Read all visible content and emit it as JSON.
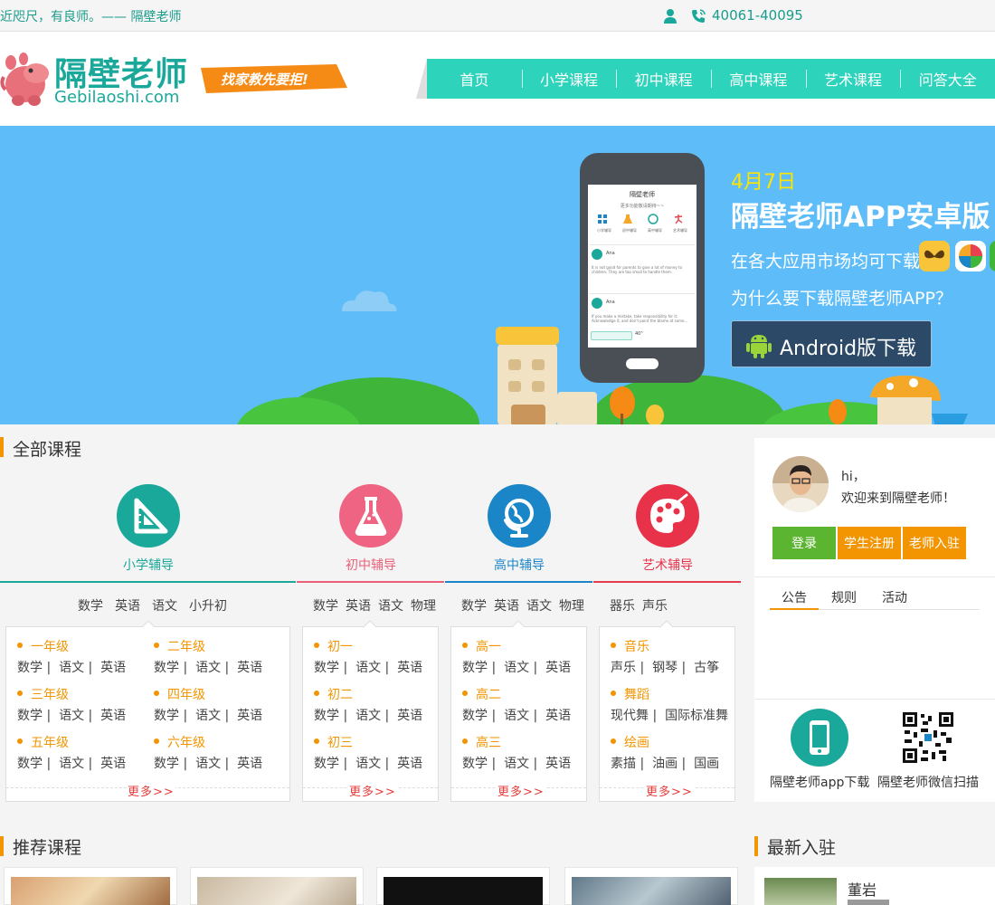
{
  "topbar": {
    "slogan": "近咫尺，有良师。—— 隔壁老师",
    "phone": "40061-40095"
  },
  "logo": {
    "name_cn": "隔壁老师",
    "name_en": "Gebilaoshi.com",
    "tagline": "找家教先要拒!"
  },
  "nav": {
    "items": [
      "首页",
      "小学课程",
      "初中课程",
      "高中课程",
      "艺术课程",
      "问答大全"
    ]
  },
  "banner": {
    "date": "4月7日",
    "title": "隔壁老师APP安卓版",
    "sub1": "在各大应用市场均可下载",
    "sub2": "为什么要下载隔壁老师APP？",
    "android_button": "Android版下载",
    "phone_screen": {
      "title": "隔壁老师",
      "subtitle": "更多功能敬请期待~~",
      "icons": [
        "小学辅导",
        "初中辅导",
        "高中辅导",
        "艺术辅导"
      ],
      "posts": [
        {
          "name": "Ana",
          "text": "It is not good for parents to give a lot of money to children. They are too small to handle them."
        },
        {
          "name": "Ana",
          "text": "If you make a mistake, take responsibility for it. Acknowledge it, and don't point the blame at some..."
        }
      ],
      "audio": "40\""
    }
  },
  "courses": {
    "title": "全部课程",
    "more": "更多>>",
    "categories": [
      {
        "label": "小学辅导",
        "color": "#1aa89a",
        "tabs": [
          "数学",
          "英语",
          "语文",
          "小升初"
        ],
        "groups": [
          {
            "name": "一年级",
            "subjects": [
              "数学",
              "语文",
              "英语"
            ]
          },
          {
            "name": "二年级",
            "subjects": [
              "数学",
              "语文",
              "英语"
            ]
          },
          {
            "name": "三年级",
            "subjects": [
              "数学",
              "语文",
              "英语"
            ]
          },
          {
            "name": "四年级",
            "subjects": [
              "数学",
              "语文",
              "英语"
            ]
          },
          {
            "name": "五年级",
            "subjects": [
              "数学",
              "语文",
              "英语"
            ]
          },
          {
            "name": "六年级",
            "subjects": [
              "数学",
              "语文",
              "英语"
            ]
          }
        ]
      },
      {
        "label": "初中辅导",
        "color": "#e8607a",
        "tabs": [
          "数学",
          "英语",
          "语文",
          "物理"
        ],
        "groups": [
          {
            "name": "初一",
            "subjects": [
              "数学",
              "语文",
              "英语"
            ]
          },
          {
            "name": "初二",
            "subjects": [
              "数学",
              "语文",
              "英语"
            ]
          },
          {
            "name": "初三",
            "subjects": [
              "数学",
              "语文",
              "英语"
            ]
          }
        ]
      },
      {
        "label": "高中辅导",
        "color": "#1a86c8",
        "tabs": [
          "数学",
          "英语",
          "语文",
          "物理"
        ],
        "groups": [
          {
            "name": "高一",
            "subjects": [
              "数学",
              "语文",
              "英语"
            ]
          },
          {
            "name": "高二",
            "subjects": [
              "数学",
              "语文",
              "英语"
            ]
          },
          {
            "name": "高三",
            "subjects": [
              "数学",
              "语文",
              "英语"
            ]
          }
        ]
      },
      {
        "label": "艺术辅导",
        "color": "#e83a4e",
        "tabs": [
          "器乐",
          "声乐"
        ],
        "groups": [
          {
            "name": "音乐",
            "subjects": [
              "声乐",
              "钢琴",
              "古筝"
            ]
          },
          {
            "name": "舞蹈",
            "subjects": [
              "现代舞",
              "国际标准舞"
            ]
          },
          {
            "name": "绘画",
            "subjects": [
              "素描",
              "油画",
              "国画"
            ]
          }
        ]
      }
    ]
  },
  "sidebar": {
    "hi": "hi，",
    "welcome": "欢迎来到隔壁老师！",
    "login": "登录",
    "register": "学生注册",
    "teacher": "老师入驻",
    "tabs": [
      "公告",
      "规则",
      "活动"
    ],
    "app_download": "隔壁老师app下载",
    "wechat_scan": "隔壁老师微信扫描"
  },
  "recommended": {
    "title": "推荐课程"
  },
  "newest": {
    "title": "最新入驻",
    "first_name": "董岩"
  },
  "colors": {
    "brand": "#1aa89a",
    "nav": "#2ed3bc",
    "accent": "#f29500",
    "login": "#5cb531"
  }
}
